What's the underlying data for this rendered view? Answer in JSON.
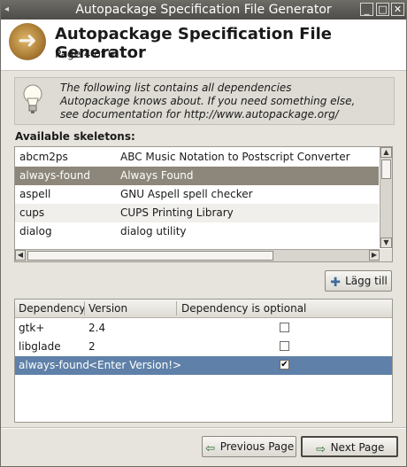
{
  "window": {
    "title": "Autopackage Specification File Generator"
  },
  "header": {
    "title": "Autopackage Specification File Generator",
    "subtitle": "Page 4 of 6"
  },
  "info": {
    "lines": [
      "The following list contains all dependencies",
      "Autopackage knows about. If you need something else,",
      "see documentation for http://www.autopackage.org/"
    ]
  },
  "skeletons": {
    "label": "Available skeletons:",
    "rows": [
      {
        "name": "abcm2ps",
        "desc": "ABC Music Notation to Postscript Converter",
        "selected": false
      },
      {
        "name": "always-found",
        "desc": "Always Found",
        "selected": true
      },
      {
        "name": "aspell",
        "desc": "GNU Aspell spell checker",
        "selected": false
      },
      {
        "name": "cups",
        "desc": "CUPS Printing Library",
        "selected": false
      },
      {
        "name": "dialog",
        "desc": "dialog utility",
        "selected": false
      }
    ]
  },
  "buttons": {
    "add": "Lägg till",
    "prev": "Previous Page",
    "next": "Next Page"
  },
  "dependencies": {
    "columns": [
      "Dependency",
      "Version",
      "Dependency is optional"
    ],
    "rows": [
      {
        "name": "gtk+",
        "version": "2.4",
        "optional": false,
        "selected": false
      },
      {
        "name": "libglade",
        "version": "2",
        "optional": false,
        "selected": false
      },
      {
        "name": "always-found",
        "version": "<Enter Version!>",
        "optional": true,
        "selected": true
      }
    ]
  }
}
